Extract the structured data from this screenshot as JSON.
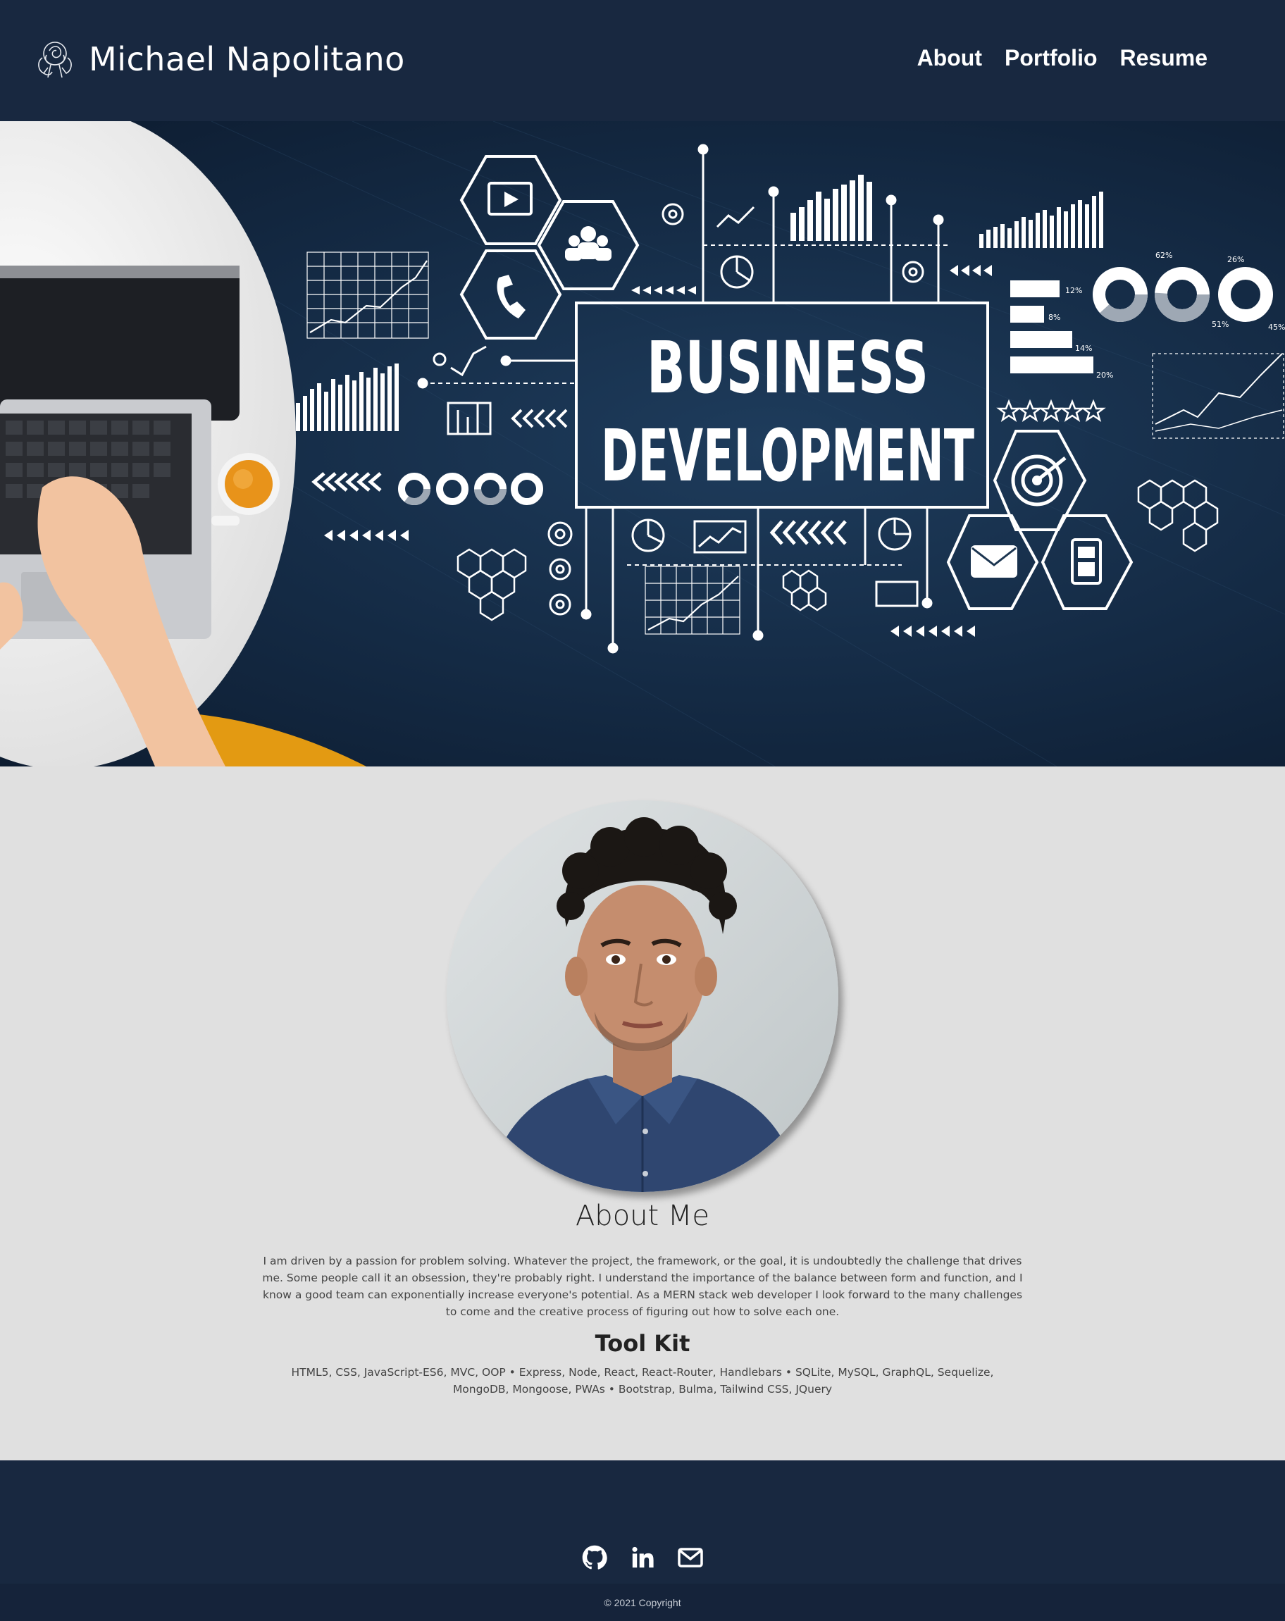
{
  "header": {
    "brand_name": "Michael Napolitano",
    "logo_icon": "rose-icon",
    "nav": [
      "About",
      "Portfolio",
      "Resume"
    ]
  },
  "hero": {
    "image_text_line1": "BUSINESS",
    "image_text_line2": "DEVELOPMENT",
    "image_percent_labels": [
      "62%",
      "26%",
      "51%",
      "45%",
      "12%",
      "8%",
      "14%",
      "20%"
    ]
  },
  "about": {
    "title": "About Me",
    "text": "I am driven by a passion for problem solving. Whatever the project, the framework, or the goal, it is undoubtedly the challenge that drives me. Some people call it an obsession, they're probably right. I understand the importance of the balance between form and function, and I know a good team can exponentially increase everyone's potential. As a MERN stack web developer I look forward to the many challenges to come and the creative process of figuring out how to solve each one."
  },
  "toolkit": {
    "title": "Tool Kit",
    "text": "HTML5, CSS, JavaScript-ES6, MVC, OOP • Express, Node, React, React-Router, Handlebars • SQLite, MySQL, GraphQL, Sequelize, MongoDB, Mongoose, PWAs • Bootstrap, Bulma, Tailwind CSS, JQuery"
  },
  "footer": {
    "social_icons": [
      "github-icon",
      "linkedin-icon",
      "envelope-icon"
    ],
    "copyright": "© 2021 Copyright"
  },
  "colors": {
    "header_bg": "#182840",
    "page_bg": "#e0e0e0",
    "footer_bg": "#182840",
    "copyright_bg": "#15233a"
  }
}
